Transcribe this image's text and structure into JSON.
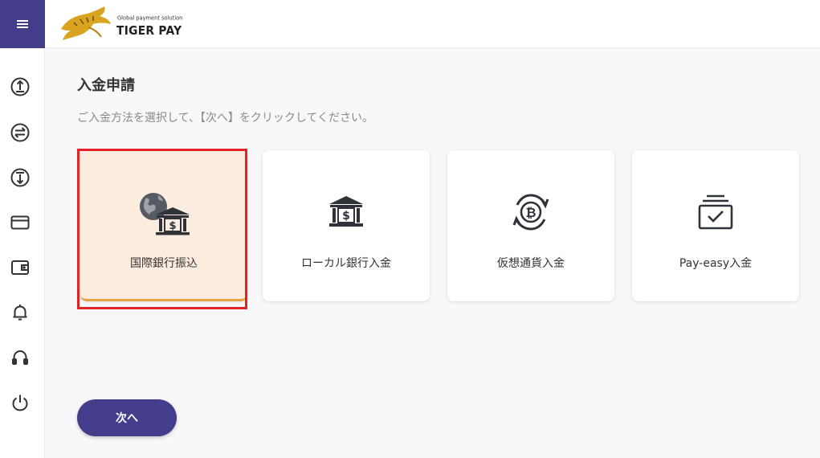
{
  "header": {
    "brand_tagline": "Global payment solution",
    "brand_name": "TIGER PAY",
    "menu_icon": "hamburger-icon"
  },
  "sidebar": {
    "icons": [
      "deposit-icon",
      "transfer-icon",
      "withdraw-icon",
      "card-icon",
      "wallet-icon",
      "bell-icon",
      "headset-icon",
      "power-icon"
    ]
  },
  "page": {
    "title": "入金申請",
    "subtitle": "ご入金方法を選択して、【次へ】をクリックしてください。"
  },
  "methods": [
    {
      "label": "国際銀行振込",
      "icon": "globe-bank-icon",
      "selected": true
    },
    {
      "label": "ローカル銀行入金",
      "icon": "bank-icon",
      "selected": false
    },
    {
      "label": "仮想通貨入金",
      "icon": "bitcoin-icon",
      "selected": false
    },
    {
      "label": "Pay-easy入金",
      "icon": "inbox-check-icon",
      "selected": false
    }
  ],
  "actions": {
    "next_label": "次へ"
  },
  "colors": {
    "primary": "#433d8b",
    "selected_bg": "#fcebdf",
    "selected_accent": "#e7a43c",
    "highlight_frame": "#e02424"
  }
}
